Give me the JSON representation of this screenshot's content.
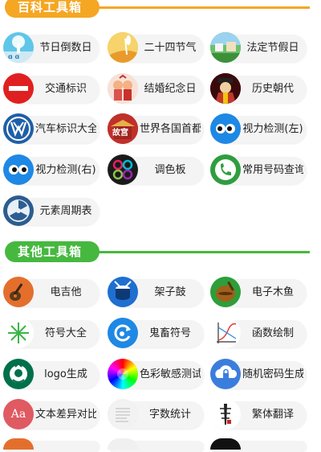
{
  "sections": [
    {
      "title": "百科工具箱",
      "items": [
        {
          "label": "节日倒数日",
          "icon": "calendar-tree-icon"
        },
        {
          "label": "二十四节气",
          "icon": "wheat-field-icon"
        },
        {
          "label": "法定节假日",
          "icon": "holiday-landscape-icon"
        },
        {
          "label": "交通标识",
          "icon": "no-entry-sign-icon"
        },
        {
          "label": "结婚纪念日",
          "icon": "wedding-couple-icon"
        },
        {
          "label": "历史朝代",
          "icon": "ancient-figure-icon"
        },
        {
          "label": "汽车标识大全",
          "icon": "vw-logo-icon"
        },
        {
          "label": "世界各国首都",
          "icon": "china-capital-icon",
          "badge": "故宫"
        },
        {
          "label": "视力检测(左)",
          "icon": "eye-left-icon"
        },
        {
          "label": "视力检测(右)",
          "icon": "eye-right-icon"
        },
        {
          "label": "调色板",
          "icon": "color-palette-icon"
        },
        {
          "label": "常用号码查询",
          "icon": "phone-icon"
        },
        {
          "label": "元素周期表",
          "icon": "radiation-icon"
        }
      ]
    },
    {
      "title": "其他工具箱",
      "items": [
        {
          "label": "电吉他",
          "icon": "guitar-icon"
        },
        {
          "label": "架子鼓",
          "icon": "drum-icon"
        },
        {
          "label": "电子木鱼",
          "icon": "wooden-fish-icon"
        },
        {
          "label": "符号大全",
          "icon": "asterisk-symbol-icon"
        },
        {
          "label": "鬼畜符号",
          "icon": "refresh-music-icon"
        },
        {
          "label": "函数绘制",
          "icon": "function-graph-icon"
        },
        {
          "label": "logo生成",
          "icon": "starbucks-logo-icon"
        },
        {
          "label": "色彩敏感测试",
          "icon": "color-wheel-icon"
        },
        {
          "label": "随机密码生成",
          "icon": "cloud-lock-icon"
        },
        {
          "label": "文本差异对比",
          "icon": "font-aa-icon",
          "badge": "Aa"
        },
        {
          "label": "字数统计",
          "icon": "word-count-icon"
        },
        {
          "label": "繁体翻译",
          "icon": "calligraphy-icon"
        }
      ]
    }
  ],
  "colors": {
    "section1": "#f5a623",
    "section2": "#46b83f"
  }
}
